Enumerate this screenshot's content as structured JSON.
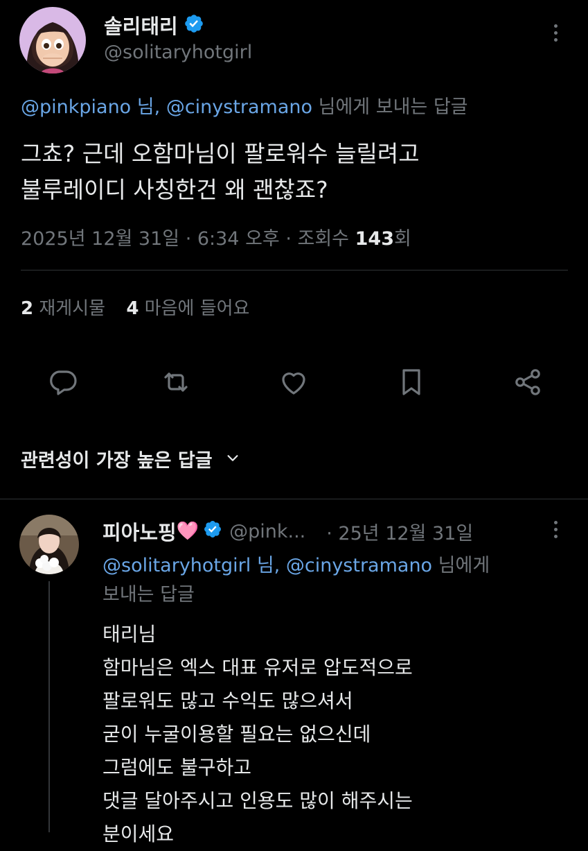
{
  "main_tweet": {
    "display_name": "솔리태리",
    "handle": "@solitaryhotgirl",
    "reply_to": {
      "mention1": "@pinkpiano 님,",
      "mention2": "@cinystramano",
      "suffix": "님에게 보내는 답글"
    },
    "text_lines": [
      "그쵸? 근데 오함마님이 팔로워수 늘릴려고",
      "불루레이디 사칭한건 왜 괜찮죠?"
    ],
    "meta": {
      "date_time": "2025년 12월 31일 · 6:34 오후 · 조회수",
      "views": "143",
      "views_suffix": "회"
    },
    "stats": {
      "retweets_count": "2",
      "retweets_label": "재게시물",
      "likes_count": "4",
      "likes_label": "마음에 들어요"
    },
    "actions": [
      "reply-icon",
      "retweet-icon",
      "heart-icon",
      "bookmark-icon",
      "share-icon"
    ]
  },
  "sort": {
    "label": "관련성이 가장 높은 답글"
  },
  "reply_tweet": {
    "display_name": "피아노핑",
    "emoji": "🩷",
    "handle": "@pink...",
    "date": "· 25년 12월 31일",
    "reply_to": {
      "mention1": "@solitaryhotgirl 님,",
      "mention2": "@cinystramano",
      "suffix_line1": "님에게",
      "suffix_line2": "보내는 답글"
    },
    "text_lines": [
      "태리님",
      "함마님은 엑스 대표 유저로 압도적으로",
      "팔로워도 많고 수익도 많으셔서",
      "굳이 누굴이용할 필요는 없으신데",
      "그럼에도 불구하고",
      "댓글 달아주시고 인용도 많이 해주시는",
      "분이세요"
    ]
  },
  "colors": {
    "background": "#000000",
    "text": "#e7e9ea",
    "muted": "#71767b",
    "link": "#6aa6e6",
    "verified": "#1d9bf0"
  }
}
